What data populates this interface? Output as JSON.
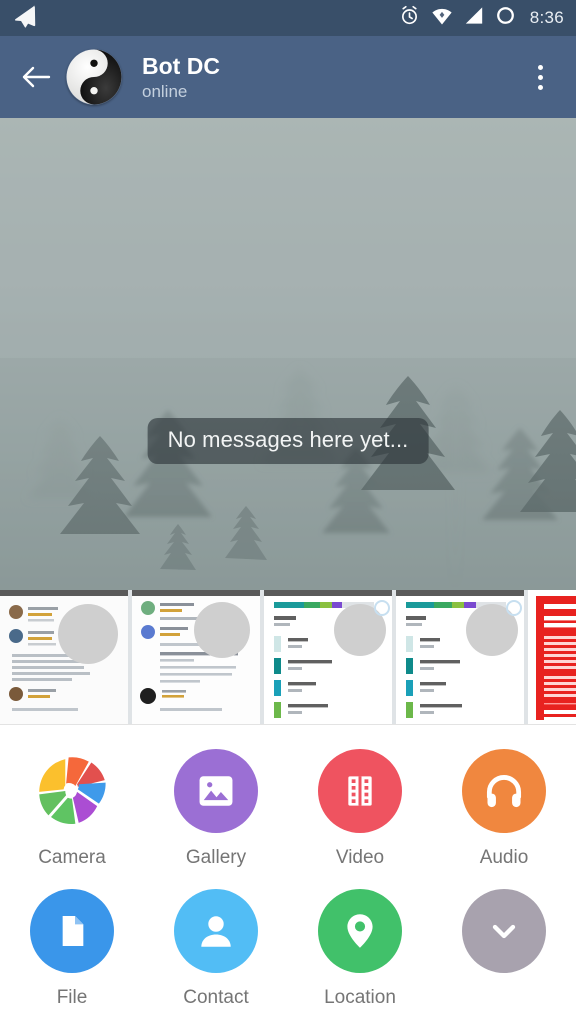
{
  "status_bar": {
    "app_icon": "telegram-paper-plane-icon",
    "icons": [
      "alarm-clock-icon",
      "wifi-icon",
      "cellular-signal-icon",
      "battery-circle-icon"
    ],
    "time": "8:36",
    "background_color": "#394f69",
    "foreground_color": "#ffffff"
  },
  "header": {
    "back_icon": "back-arrow-icon",
    "avatar_icon": "yin-yang-avatar",
    "title": "Bot DC",
    "status": "online",
    "menu_icon": "overflow-menu-icon",
    "background_color": "#4a6285",
    "title_color": "#ffffff",
    "status_color": "#c4d0de"
  },
  "chat": {
    "wallpaper": "foggy-pine-forest",
    "empty_message": "No messages here yet...",
    "banner_background": "rgba(44,52,56,0.62)"
  },
  "photo_strip": {
    "thumbnails": [
      {
        "name": "app-reviews-screenshot-1",
        "kind": "reviews"
      },
      {
        "name": "app-reviews-screenshot-2",
        "kind": "reviews"
      },
      {
        "name": "storage-settings-screenshot-1",
        "kind": "storage"
      },
      {
        "name": "storage-settings-screenshot-2",
        "kind": "storage"
      },
      {
        "name": "red-warning-screenshot",
        "kind": "warning"
      }
    ]
  },
  "attachments": {
    "rows": [
      [
        {
          "label": "Camera",
          "icon": "camera-shutter-icon",
          "color": "multicolor"
        },
        {
          "label": "Gallery",
          "icon": "image-icon",
          "color": "#9b6fd4"
        },
        {
          "label": "Video",
          "icon": "film-strip-icon",
          "color": "#ef5360"
        },
        {
          "label": "Audio",
          "icon": "headphones-icon",
          "color": "#f0873f"
        }
      ],
      [
        {
          "label": "File",
          "icon": "document-icon",
          "color": "#3a96ea"
        },
        {
          "label": "Contact",
          "icon": "person-icon",
          "color": "#52bdf5"
        },
        {
          "label": "Location",
          "icon": "map-pin-icon",
          "color": "#41c16a"
        },
        {
          "label": "",
          "icon": "chevron-down-icon",
          "color": "#a8a2ae"
        }
      ]
    ],
    "label_color": "#757575",
    "panel_background": "#ffffff"
  }
}
